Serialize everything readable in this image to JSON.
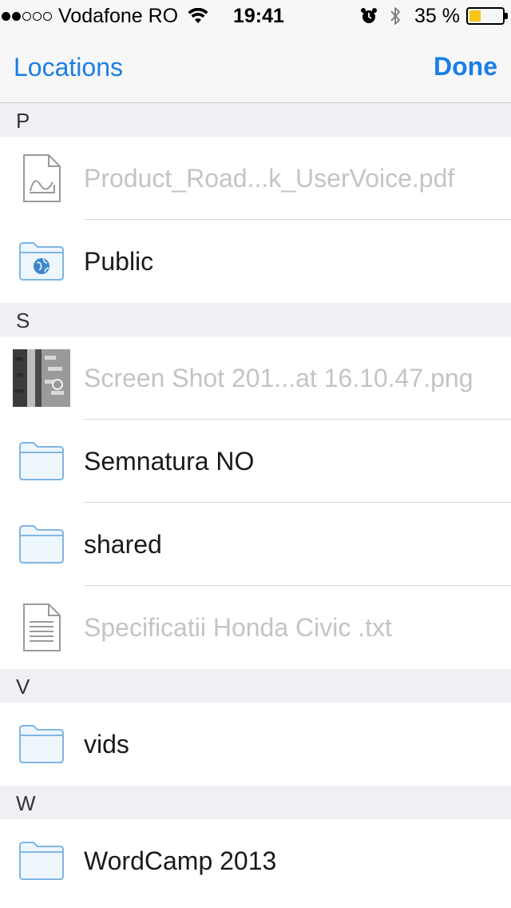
{
  "status_bar": {
    "carrier": "Vodafone RO",
    "time": "19:41",
    "battery_percent": "35 %",
    "battery_level": 0.35,
    "signal_bars": 2,
    "signal_total": 5
  },
  "nav": {
    "back_label": "Locations",
    "done_label": "Done",
    "accent_color": "#1a7ee6"
  },
  "sections": [
    {
      "letter": "P",
      "items": [
        {
          "name": "Product_Road...k_UserVoice.pdf",
          "type": "pdf",
          "enabled": false
        },
        {
          "name": "Public",
          "type": "public-folder",
          "enabled": true
        }
      ]
    },
    {
      "letter": "S",
      "items": [
        {
          "name": "Screen Shot 201...at 16.10.47.png",
          "type": "image",
          "enabled": false
        },
        {
          "name": "Semnatura NO",
          "type": "folder",
          "enabled": true
        },
        {
          "name": "shared",
          "type": "folder",
          "enabled": true
        },
        {
          "name": "Specificatii Honda Civic .txt",
          "type": "txt",
          "enabled": false
        }
      ]
    },
    {
      "letter": "V",
      "items": [
        {
          "name": "vids",
          "type": "folder",
          "enabled": true
        }
      ]
    },
    {
      "letter": "W",
      "items": [
        {
          "name": "WordCamp 2013",
          "type": "folder",
          "enabled": true
        }
      ]
    }
  ]
}
